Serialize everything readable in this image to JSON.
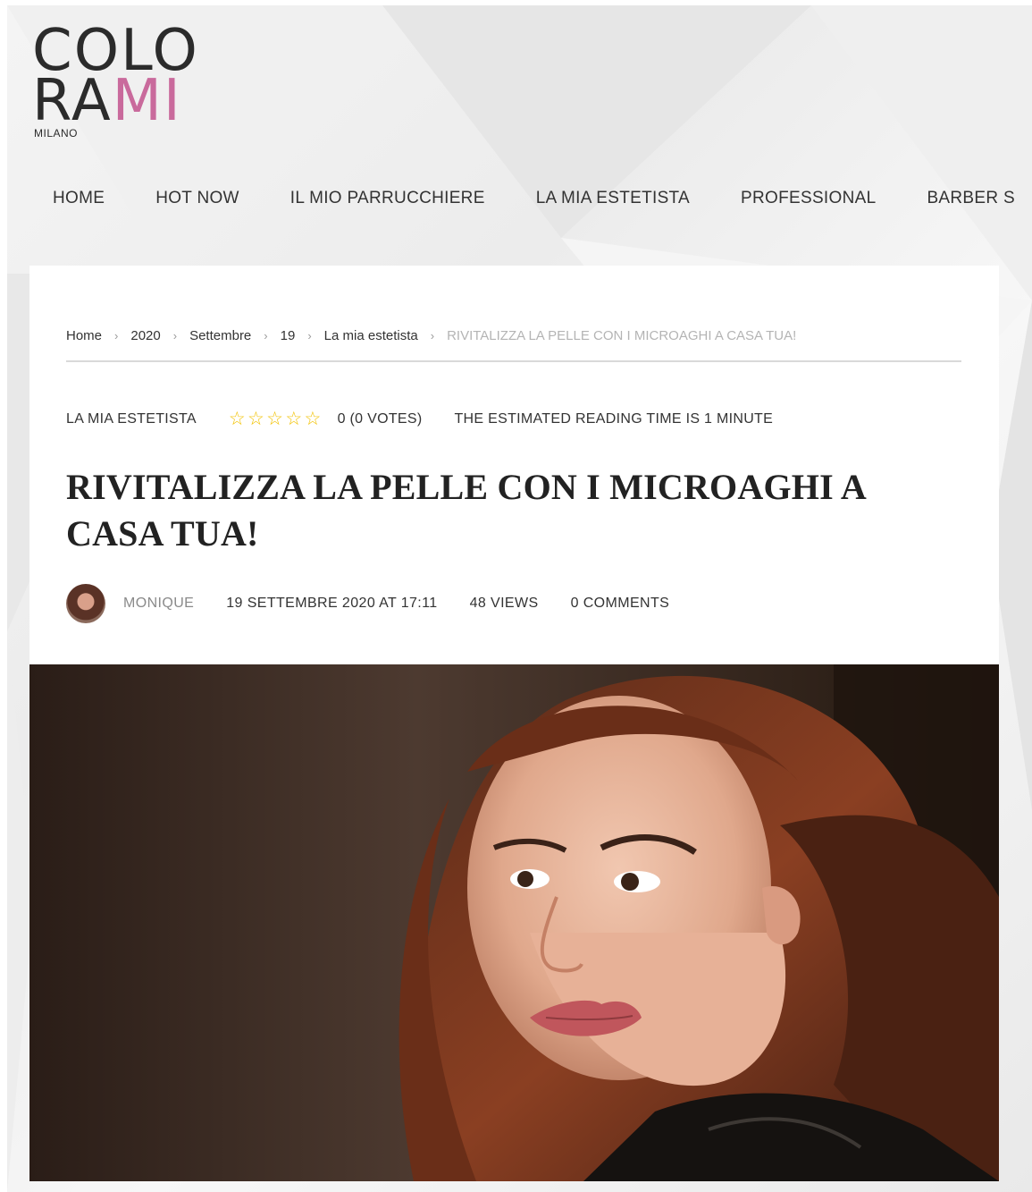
{
  "logo": {
    "line1": "COLO",
    "line2_dark": "RA",
    "line2_pink": "MI",
    "sub": "MILANO"
  },
  "nav": {
    "items": [
      {
        "label": "HOME"
      },
      {
        "label": "HOT NOW"
      },
      {
        "label": "IL MIO PARRUCCHIERE"
      },
      {
        "label": "LA MIA ESTETISTA"
      },
      {
        "label": "PROFESSIONAL"
      },
      {
        "label": "BARBER S"
      }
    ]
  },
  "breadcrumb": {
    "items": [
      {
        "label": "Home"
      },
      {
        "label": "2020"
      },
      {
        "label": "Settembre"
      },
      {
        "label": "19"
      },
      {
        "label": "La mia estetista"
      }
    ],
    "separator": "›",
    "current": "RIVITALIZZA LA PELLE CON I MICROAGHI A CASA TUA!"
  },
  "post": {
    "category": "LA MIA ESTETISTA",
    "rating": {
      "stars_filled": 0,
      "stars_total": 5,
      "star_glyph": "☆",
      "label": "0 (0 VOTES)"
    },
    "reading_time": "THE ESTIMATED READING TIME IS 1 MINUTE",
    "title": "RIVITALIZZA LA PELLE CON I MICROAGHI A CASA TUA!",
    "author": "MONIQUE",
    "date": "19 SETTEMBRE 2020 AT 17:11",
    "views": "48 VIEWS",
    "comments": "0 COMMENTS"
  },
  "colors": {
    "accent_pink": "#c96a9c",
    "star_yellow": "#f2c200",
    "text_dark": "#222222"
  }
}
